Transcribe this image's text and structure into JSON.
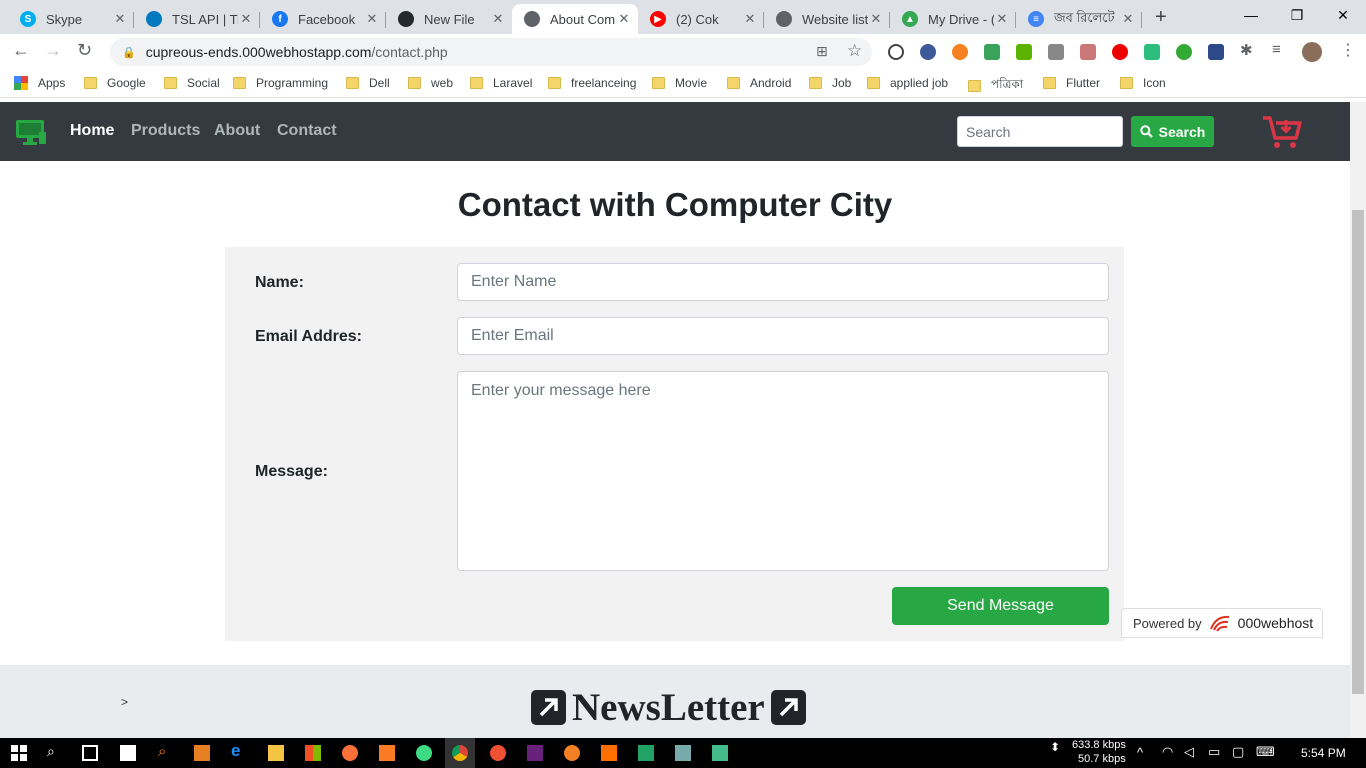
{
  "browser": {
    "tabs": [
      {
        "title": "Skype",
        "color": "#00aff0",
        "glyph": "S"
      },
      {
        "title": "TSL API | Tre",
        "color": "#0079bf",
        "glyph": ""
      },
      {
        "title": "Facebook",
        "color": "#1877f2",
        "glyph": "f"
      },
      {
        "title": "New File",
        "color": "#24292e",
        "glyph": ""
      },
      {
        "title": "About Com",
        "color": "#5f6368",
        "glyph": ""
      },
      {
        "title": "(2) Cok",
        "color": "#ff0000",
        "glyph": "▶"
      },
      {
        "title": "Website list",
        "color": "#5f6368",
        "glyph": ""
      },
      {
        "title": "My Drive - (",
        "color": "#34a853",
        "glyph": "▲"
      },
      {
        "title": "জব রিলেটে",
        "color": "#4285f4",
        "glyph": "≡"
      }
    ],
    "new_tab": "+",
    "window_controls": {
      "minimize": "—",
      "restore": "❐",
      "close": "✕"
    },
    "url_host": "cupreous-ends.000webhostapp.com",
    "url_path": "/contact.php",
    "bookmarks": [
      "Apps",
      "Google",
      "Social",
      "Programming",
      "Dell",
      "web",
      "Laravel",
      "freelanceing",
      "Movie",
      "Android",
      "Job",
      "applied job",
      "পত্রিকা",
      "Flutter",
      "Icon"
    ]
  },
  "navbar": {
    "links": [
      "Home",
      "Products",
      "About",
      "Contact"
    ],
    "search_placeholder": "Search",
    "search_button": "Search",
    "brand_icon": "computer-icon",
    "cart_icon": "cart-icon",
    "accent": "#28a745",
    "cart_color": "#dc3545"
  },
  "main": {
    "title": "Contact with Computer City",
    "form": {
      "name_label": "Name:",
      "name_placeholder": "Enter Name",
      "email_label": "Email Addres:",
      "email_placeholder": "Enter Email",
      "message_label": "Message:",
      "message_placeholder": "Enter your message here",
      "send_button": "Send Message"
    }
  },
  "footer": {
    "chevron": ">",
    "newsletter_title": "NewsLetter"
  },
  "powered": {
    "prefix": "Powered by",
    "brand": "000webhost"
  },
  "taskbar": {
    "net_down": "633.8 kbps",
    "net_up": "50.7 kbps",
    "time": "5:54 PM"
  }
}
